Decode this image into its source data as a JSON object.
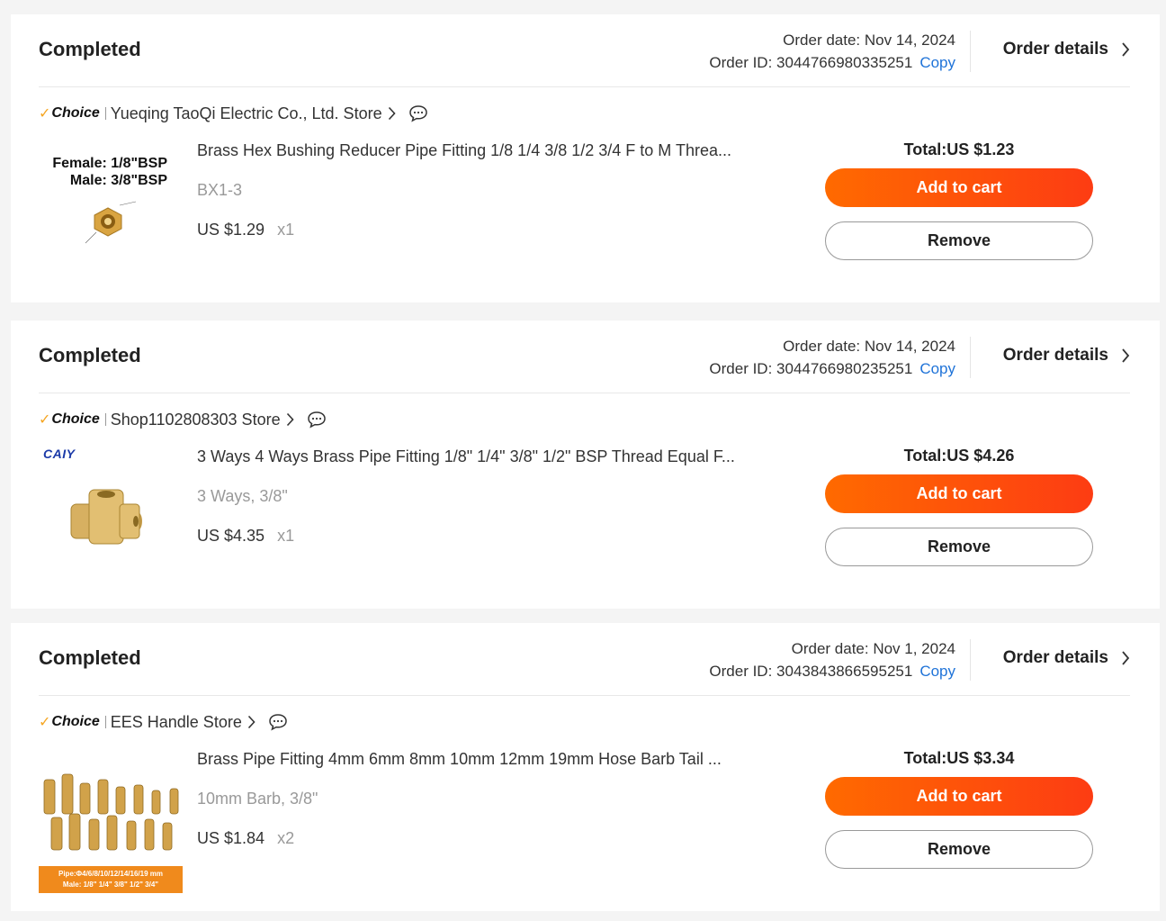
{
  "orders": [
    {
      "status": "Completed",
      "order_date": "Order date: Nov 14, 2024",
      "order_id": "Order ID: 3044766980335251",
      "copy_label": "Copy",
      "details_label": "Order details",
      "choice_label": "Choice",
      "store_name": "Yueqing TaoQi Electric Co., Ltd. Store",
      "product_title": "Brass Hex Bushing Reducer Pipe Fitting 1/8 1/4 3/8 1/2 3/4 F to M Threa...",
      "variant": "BX1-3",
      "price": "US $1.29",
      "qty": "x1",
      "total": "Total:US $1.23",
      "add_to_cart_label": "Add to cart",
      "remove_label": "Remove",
      "image_text": "Female: 1/8\"BSP\nMale: 3/8\"BSP"
    },
    {
      "status": "Completed",
      "order_date": "Order date: Nov 14, 2024",
      "order_id": "Order ID: 3044766980235251",
      "copy_label": "Copy",
      "details_label": "Order details",
      "choice_label": "Choice",
      "store_name": "Shop1102808303 Store",
      "product_title": "3 Ways 4 Ways Brass Pipe Fitting 1/8\" 1/4\" 3/8\" 1/2\" BSP Thread Equal F...",
      "variant": "3 Ways, 3/8\"",
      "price": "US $4.35",
      "qty": "x1",
      "total": "Total:US $4.26",
      "add_to_cart_label": "Add to cart",
      "remove_label": "Remove",
      "image_text": "CAIY"
    },
    {
      "status": "Completed",
      "order_date": "Order date: Nov 1, 2024",
      "order_id": "Order ID: 3043843866595251",
      "copy_label": "Copy",
      "details_label": "Order details",
      "choice_label": "Choice",
      "store_name": "EES Handle Store",
      "product_title": "Brass Pipe Fitting 4mm 6mm 8mm 10mm 12mm 19mm Hose Barb Tail ...",
      "variant": "10mm Barb, 3/8\"",
      "price": "US $1.84",
      "qty": "x2",
      "total": "Total:US $3.34",
      "add_to_cart_label": "Add to cart",
      "remove_label": "Remove",
      "image_text": "Pipe:Φ4/6/8/10/12/14/16/19 mm\nMale: 1/8\" 1/4\" 3/8\" 1/2\" 3/4\""
    }
  ],
  "colors": {
    "accent_orange": "#fd5a13",
    "link_blue": "#1f73d8",
    "choice_check": "#f5a623"
  },
  "icons": [
    "chevron-right-icon",
    "chat-bubble-icon",
    "check-icon"
  ]
}
